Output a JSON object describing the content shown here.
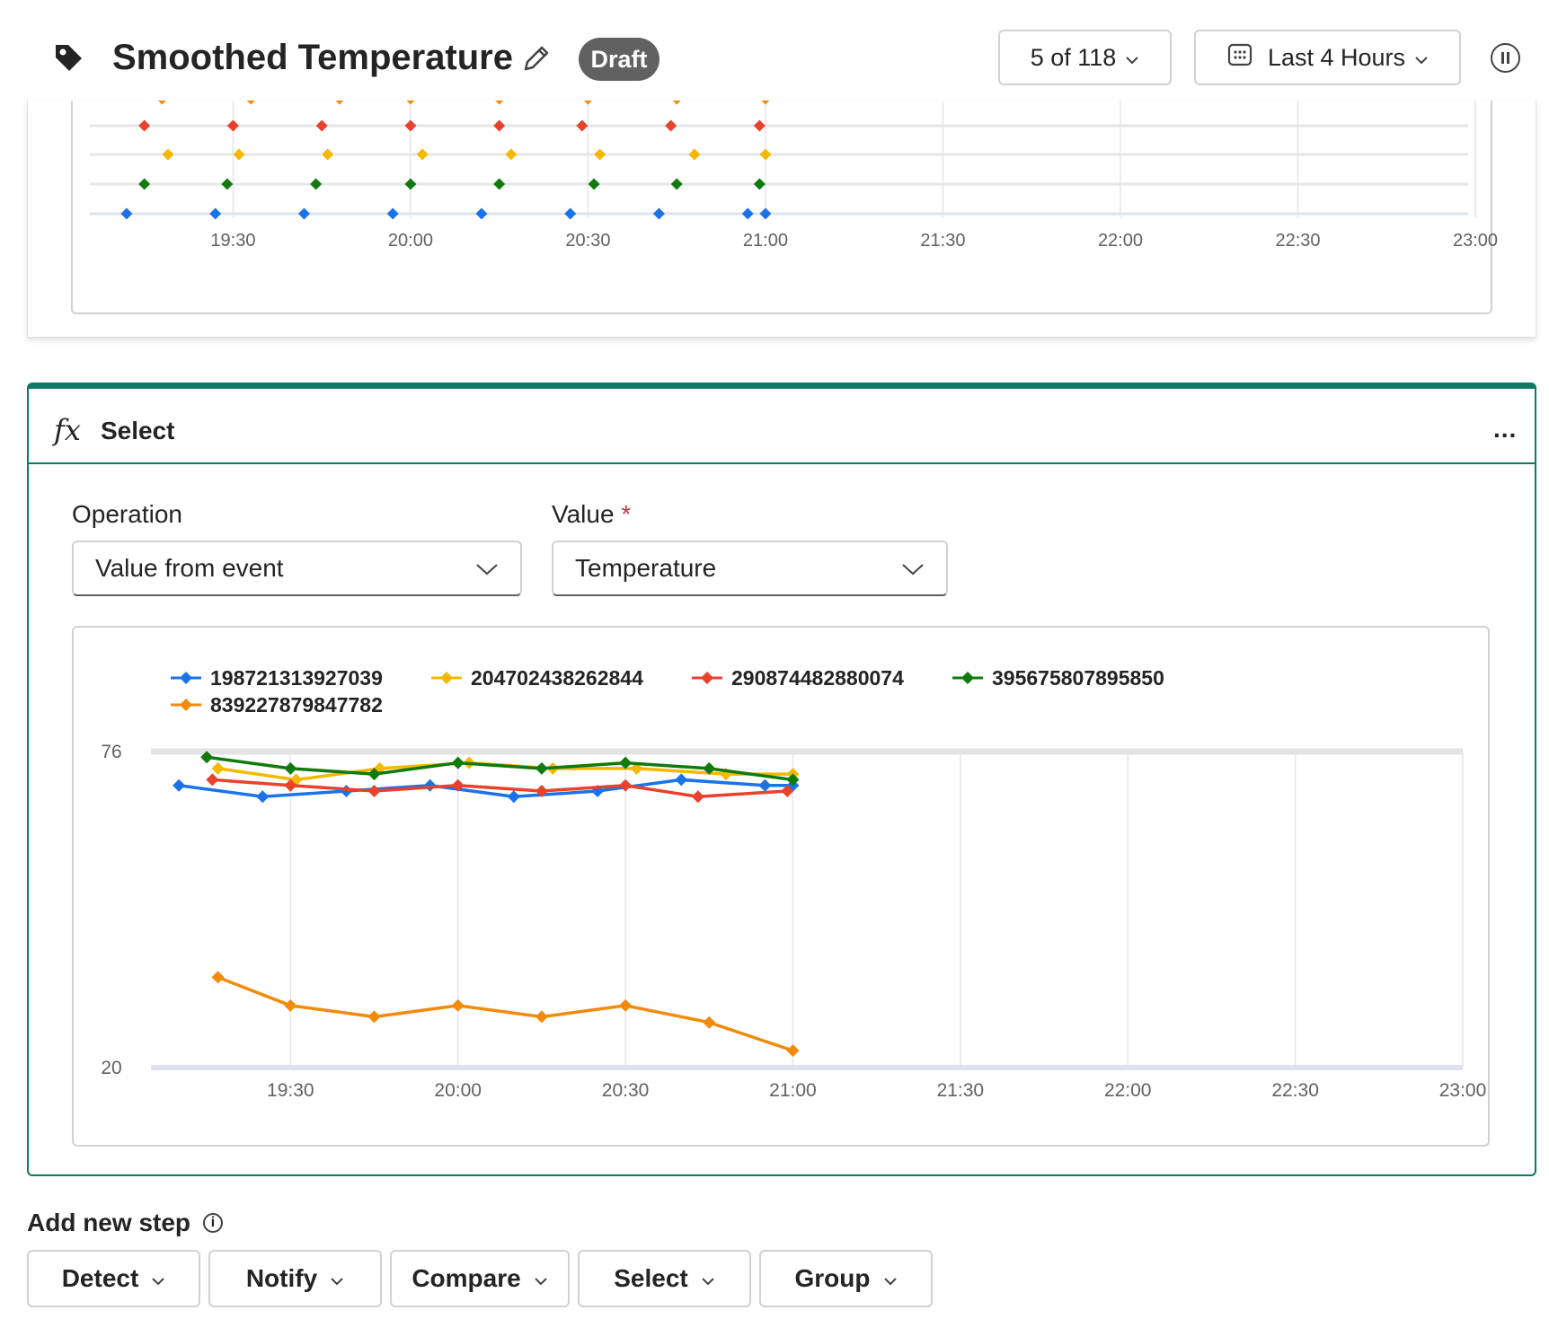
{
  "header": {
    "title": "Smoothed Temperature",
    "status_badge": "Draft",
    "paging_label": "5 of 118",
    "time_range_label": "Last 4 Hours",
    "icons": [
      "tag-icon",
      "edit-icon",
      "chevron-down-icon",
      "calendar-icon",
      "pause-icon"
    ]
  },
  "select_card": {
    "icon": "fx",
    "title": "Select",
    "more_label": "...",
    "operation": {
      "label": "Operation",
      "value": "Value from event"
    },
    "value_field": {
      "label": "Value",
      "required_mark": "*",
      "value": "Temperature"
    }
  },
  "add_step": {
    "label": "Add new step",
    "info_icon": "i",
    "buttons": [
      "Detect",
      "Notify",
      "Compare",
      "Select",
      "Group"
    ]
  },
  "colors": {
    "accent": "#117865",
    "blue": "#1a73e8",
    "yellow": "#f5b800",
    "red": "#e8412c",
    "green": "#117a0e",
    "orange": "#f38a0c"
  },
  "chart_data": [
    {
      "type": "scatter",
      "title": "",
      "x_ticks": [
        "19:30",
        "20:00",
        "20:30",
        "21:00",
        "21:30",
        "22:00",
        "22:30",
        "23:00"
      ],
      "xlim": [
        "19:07",
        "23:00"
      ],
      "rows": [
        {
          "color": "#f38a0c",
          "x": [
            "19:18",
            "19:33",
            "19:48",
            "20:00",
            "20:15",
            "20:30",
            "20:45",
            "21:00"
          ]
        },
        {
          "color": "#e8412c",
          "x": [
            "19:15",
            "19:30",
            "19:45",
            "20:00",
            "20:15",
            "20:29",
            "20:44",
            "20:59"
          ]
        },
        {
          "color": "#f5b800",
          "x": [
            "19:19",
            "19:31",
            "19:46",
            "20:02",
            "20:17",
            "20:32",
            "20:48",
            "21:00"
          ]
        },
        {
          "color": "#117a0e",
          "x": [
            "19:15",
            "19:29",
            "19:44",
            "20:00",
            "20:15",
            "20:31",
            "20:45",
            "20:59"
          ]
        },
        {
          "color": "#1a73e8",
          "x": [
            "19:12",
            "19:27",
            "19:42",
            "19:57",
            "20:12",
            "20:27",
            "20:42",
            "20:57",
            "21:00"
          ]
        }
      ]
    },
    {
      "type": "line",
      "title": "",
      "x_ticks": [
        "19:30",
        "20:00",
        "20:30",
        "21:00",
        "21:30",
        "22:00",
        "22:30",
        "23:00"
      ],
      "y_ticks": [
        76,
        20
      ],
      "ylim": [
        20,
        76
      ],
      "xlim": [
        "19:05",
        "23:00"
      ],
      "grid": true,
      "legend_position": "top-left",
      "series": [
        {
          "name": "198721313927039",
          "color": "#1a73e8",
          "x": [
            "19:10",
            "19:25",
            "19:40",
            "19:55",
            "20:10",
            "20:25",
            "20:40",
            "20:55",
            "21:00"
          ],
          "y": [
            70,
            68,
            69,
            70,
            68,
            69,
            71,
            70,
            70
          ]
        },
        {
          "name": "204702438262844",
          "color": "#f5b800",
          "x": [
            "19:17",
            "19:31",
            "19:46",
            "20:02",
            "20:17",
            "20:32",
            "20:48",
            "21:00"
          ],
          "y": [
            73,
            71,
            73,
            74,
            73,
            73,
            72,
            72
          ]
        },
        {
          "name": "290874482880074",
          "color": "#e8412c",
          "x": [
            "19:16",
            "19:30",
            "19:45",
            "20:00",
            "20:15",
            "20:30",
            "20:43",
            "20:59"
          ],
          "y": [
            71,
            70,
            69,
            70,
            69,
            70,
            68,
            69
          ]
        },
        {
          "name": "395675807895850",
          "color": "#117a0e",
          "x": [
            "19:15",
            "19:30",
            "19:45",
            "20:00",
            "20:15",
            "20:30",
            "20:45",
            "21:00"
          ],
          "y": [
            75,
            73,
            72,
            74,
            73,
            74,
            73,
            71
          ]
        },
        {
          "name": "839227879847782",
          "color": "#f38a0c",
          "x": [
            "19:17",
            "19:30",
            "19:45",
            "20:00",
            "20:15",
            "20:30",
            "20:45",
            "21:00"
          ],
          "y": [
            36,
            31,
            29,
            31,
            29,
            31,
            28,
            23
          ]
        }
      ]
    }
  ]
}
